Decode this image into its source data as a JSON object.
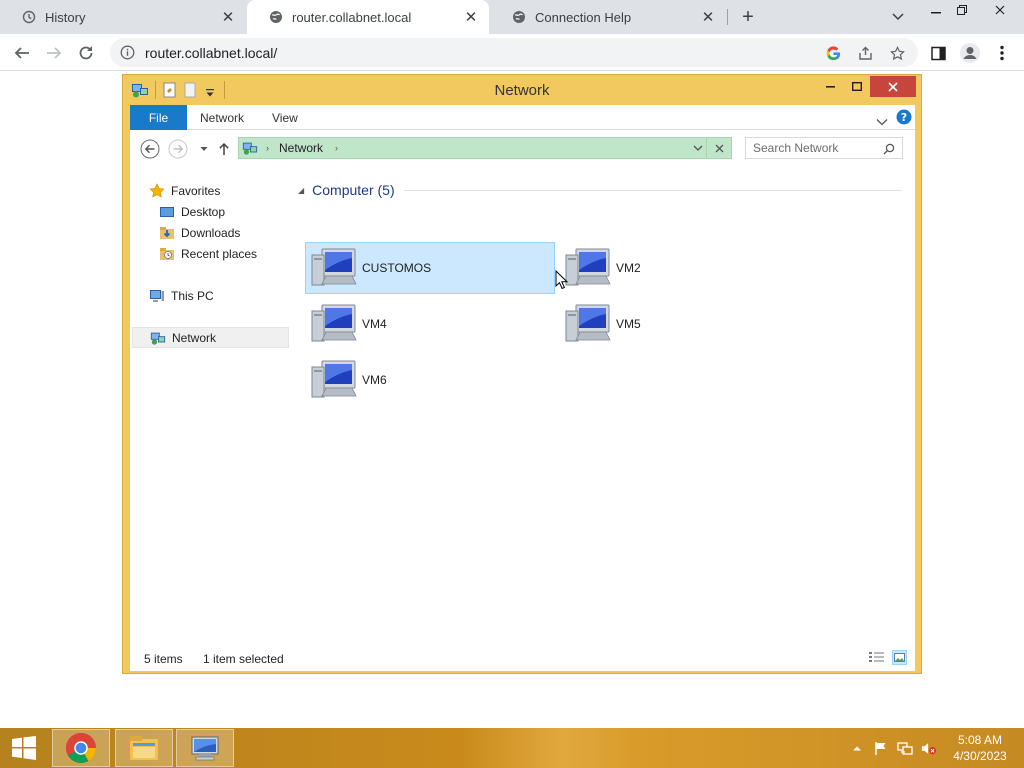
{
  "browser": {
    "tabs": [
      {
        "label": "History",
        "icon": "history-icon"
      },
      {
        "label": "router.collabnet.local",
        "icon": "globe-icon",
        "active": true
      },
      {
        "label": "Connection Help",
        "icon": "globe-icon"
      }
    ],
    "new_tab_glyph": "+",
    "url": "router.collabnet.local/"
  },
  "explorer": {
    "title": "Network",
    "ribbon_tabs": [
      "File",
      "Network",
      "View"
    ],
    "address": {
      "crumb": "Network"
    },
    "search": {
      "placeholder": "Search Network"
    },
    "nav": {
      "favorites": "Favorites",
      "favorites_items": [
        "Desktop",
        "Downloads",
        "Recent places"
      ],
      "this_pc": "This PC",
      "network": "Network"
    },
    "group": {
      "label": "Computer (5)"
    },
    "items": [
      {
        "label": "CUSTOMOS",
        "selected": true
      },
      {
        "label": "VM2",
        "selected": false
      },
      {
        "label": "VM4",
        "selected": false
      },
      {
        "label": "VM5",
        "selected": false
      },
      {
        "label": "VM6",
        "selected": false
      }
    ],
    "status": {
      "count": "5 items",
      "selection": "1 item selected"
    }
  },
  "taskbar": {
    "apps": [
      "chrome-icon",
      "file-explorer-icon",
      "remote-desktop-icon"
    ],
    "clock_time": "5:08 AM",
    "clock_date": "4/30/2023"
  },
  "colors": {
    "window_frame": "#f1c95e",
    "file_tab": "#1979ca",
    "address_bar": "#bfe6c8",
    "selection": "#cce8ff",
    "close_button": "#c7463c"
  }
}
